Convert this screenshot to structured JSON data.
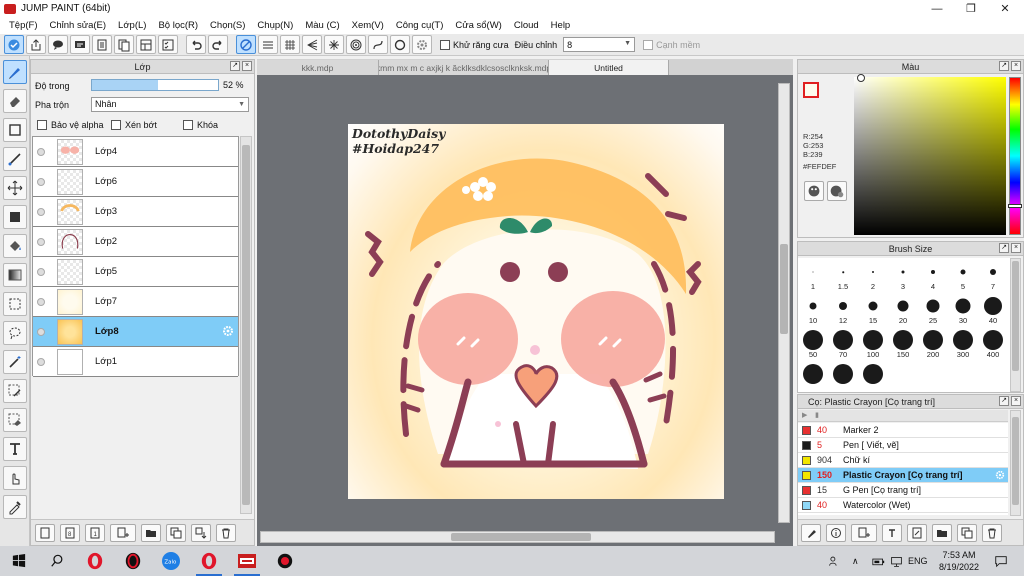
{
  "window": {
    "title": "JUMP PAINT (64bit)",
    "minimize": "—",
    "maximize": "❐",
    "close": "✕"
  },
  "menu": [
    "Tệp(F)",
    "Chỉnh sửa(E)",
    "Lớp(L)",
    "Bộ lọc(R)",
    "Chọn(S)",
    "Chụp(N)",
    "Màu (C)",
    "Xem(V)",
    "Công cụ(T)",
    "Cửa sổ(W)",
    "Cloud",
    "Help"
  ],
  "toolbar": {
    "antialias_label": "Khử răng cưa",
    "adjust_label": "Điều chỉnh",
    "adjust_value": "8",
    "smooth_label": "Cạnh mềm"
  },
  "layer_panel": {
    "title": "Lớp",
    "opacity_label": "Độ trong",
    "opacity_value": "52 %",
    "opacity_fraction": 0.52,
    "blend_label": "Pha trộn",
    "blend_value": "Nhân",
    "protect_alpha": "Bảo vệ alpha",
    "clipping": "Xén bớt",
    "lock": "Khóa",
    "layers": [
      {
        "name": "Lớp4",
        "selected": false
      },
      {
        "name": "Lớp6",
        "selected": false
      },
      {
        "name": "Lớp3",
        "selected": false
      },
      {
        "name": "Lớp2",
        "selected": false
      },
      {
        "name": "Lớp5",
        "selected": false
      },
      {
        "name": "Lớp7",
        "selected": false
      },
      {
        "name": "Lớp8",
        "selected": true
      },
      {
        "name": "Lớp1",
        "selected": false
      }
    ]
  },
  "tabs": [
    {
      "label": "kkk.mdp",
      "active": false
    },
    {
      "label": "kmm mx m c axjkj k ăcklksdklcsosclknksk.mdp",
      "active": false
    },
    {
      "label": "Untitled",
      "active": true
    }
  ],
  "artwork": {
    "signature_line1": "DotothyDaisy",
    "signature_line2": "#Hoidap247"
  },
  "color_panel": {
    "title": "Màu",
    "r": "R:254",
    "g": "G:253",
    "b": "B:239",
    "hex": "#FEFDEF",
    "current_color": "#fefdef"
  },
  "brush_panel": {
    "title": "Brush Size",
    "sizes": [
      "1",
      "1.5",
      "2",
      "3",
      "4",
      "5",
      "7",
      "10",
      "12",
      "15",
      "20",
      "25",
      "30",
      "40",
      "50",
      "70",
      "100",
      "150",
      "200",
      "300",
      "400",
      "",
      "",
      ""
    ]
  },
  "tool_panel": {
    "title": "Cọ: Plastic Crayon [Cọ trang trí]",
    "tools": [
      {
        "size": "40",
        "name": "Marker 2",
        "color": "#e83030",
        "red": true,
        "selected": false
      },
      {
        "size": "5",
        "name": "Pen [ Viết, vẽ]",
        "color": "#1a1a1a",
        "red": true,
        "selected": false
      },
      {
        "size": "904",
        "name": "Chữ kí",
        "color": "#f2e600",
        "red": false,
        "selected": false
      },
      {
        "size": "150",
        "name": "Plastic Crayon [Cọ trang trí]",
        "color": "#f2e600",
        "red": true,
        "selected": true
      },
      {
        "size": "15",
        "name": "G Pen [Cọ trang trí]",
        "color": "#e83030",
        "red": false,
        "selected": false
      },
      {
        "size": "40",
        "name": "Watercolor (Wet)",
        "color": "#8fd8f7",
        "red": true,
        "selected": false
      }
    ]
  },
  "taskbar": {
    "language": "ENG",
    "time": "7:53 AM",
    "date": "8/19/2022",
    "zalo": "Zalo"
  }
}
